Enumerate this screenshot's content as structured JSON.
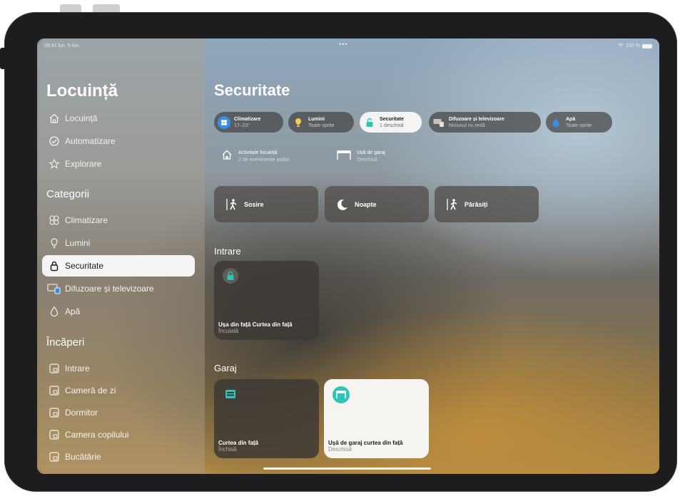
{
  "status_bar": {
    "time": "09:41 lun. 5 iun.",
    "dots": "•••",
    "battery": "100 %"
  },
  "sidebar": {
    "title": "Locuință",
    "nav": [
      {
        "label": "Locuință",
        "icon": "house-icon"
      },
      {
        "label": "Automatizare",
        "icon": "clock-icon"
      },
      {
        "label": "Explorare",
        "icon": "star-icon"
      }
    ],
    "categories_heading": "Categorii",
    "categories": [
      {
        "label": "Climatizare",
        "icon": "fan-icon"
      },
      {
        "label": "Lumini",
        "icon": "bulb-icon"
      },
      {
        "label": "Securitate",
        "icon": "lock-icon",
        "active": true
      },
      {
        "label": "Difuzoare și televizoare",
        "icon": "tv-speaker-icon"
      },
      {
        "label": "Apă",
        "icon": "drop-icon"
      }
    ],
    "rooms_heading": "Încăperi",
    "rooms": [
      {
        "label": "Intrare",
        "icon": "room-icon"
      },
      {
        "label": "Cameră de zi",
        "icon": "room-icon"
      },
      {
        "label": "Dormitor",
        "icon": "room-icon"
      },
      {
        "label": "Camera copilului",
        "icon": "room-icon"
      },
      {
        "label": "Bucătărie",
        "icon": "room-icon"
      }
    ]
  },
  "main": {
    "title": "Securitate",
    "chips": [
      {
        "title": "Climatizare",
        "subtitle": "17–23°",
        "icon": "fan-icon",
        "color": "#3a8ee6"
      },
      {
        "title": "Lumini",
        "subtitle": "Toate oprite",
        "icon": "bulb-icon",
        "color": "#f7c948"
      },
      {
        "title": "Securitate",
        "subtitle": "1 deschisă",
        "icon": "lock-icon",
        "color": "#2ec4b6",
        "active": true
      },
      {
        "title": "Difuzoare și televizoare",
        "subtitle": "Niciunul nu redă",
        "icon": "tv-speaker-icon",
        "color": "#9a9a9a"
      },
      {
        "title": "Apă",
        "subtitle": "Toate oprite",
        "icon": "drop-icon",
        "color": "#3a8ee6"
      }
    ],
    "info": [
      {
        "title": "Activitate locuință",
        "subtitle": "2 de evenimente astăzi",
        "icon": "house-icon"
      },
      {
        "title": "Ușă de garaj",
        "subtitle": "Deschisă",
        "icon": "garage-icon"
      }
    ],
    "scenes": [
      {
        "label": "Sosire",
        "icon": "person-arrive-icon"
      },
      {
        "label": "Noapte",
        "icon": "moon-icon"
      },
      {
        "label": "Părăsiți",
        "icon": "person-leave-icon"
      }
    ],
    "sections": [
      {
        "label": "Intrare",
        "tiles": [
          {
            "title": "Ușa din față Curtea din față",
            "status": "Încuiată",
            "icon": "lock-icon",
            "light": false
          }
        ]
      },
      {
        "label": "Garaj",
        "tiles": [
          {
            "title": "Curtea din față",
            "status": "Închisă",
            "icon": "garage-icon",
            "light": false
          },
          {
            "title": "Ușă de garaj curtea din față",
            "status": "Deschisă",
            "icon": "garage-icon",
            "light": true
          }
        ]
      }
    ]
  },
  "colors": {
    "accent_teal": "#2ec4b6",
    "sidebar_active_bg": "#f5f4f2"
  }
}
